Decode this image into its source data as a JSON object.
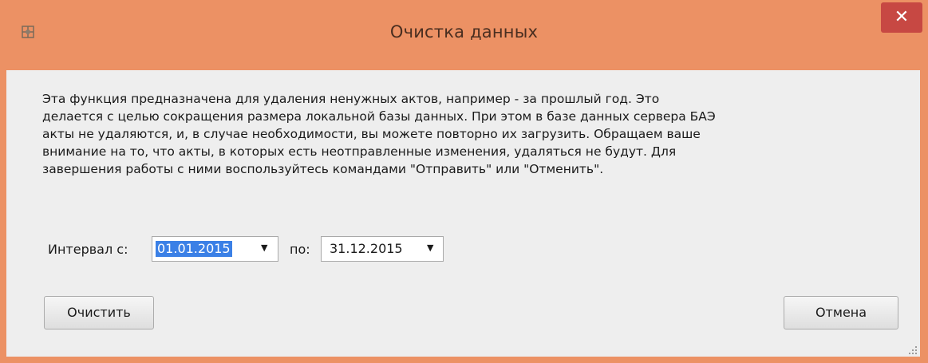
{
  "window": {
    "title": "Очистка данных",
    "close_icon": "close-icon",
    "app_icon": "app-icon"
  },
  "description": "Эта функция предназначена для удаления ненужных актов, например - за прошлый год. Это\nделается с целью сокращения размера локальной базы данных. При этом в базе данных сервера БАЭ\nакты не удаляются, и, в случае необходимости, вы можете повторно их загрузить. Обращаем ваше\nвнимание на то, что акты, в которых есть неотправленные изменения, удаляться не будут. Для\nзавершения работы с ними воспользуйтесь командами \"Отправить\" или \"Отменить\".",
  "interval": {
    "label": "Интервал с:",
    "from_value": "01.01.2015",
    "to_label": "по:",
    "to_value": "31.12.2015"
  },
  "buttons": {
    "clear": "Очистить",
    "cancel": "Отмена"
  },
  "colors": {
    "titlebar": "#ec9164",
    "close_button": "#c74843",
    "selection": "#3b80e6"
  }
}
